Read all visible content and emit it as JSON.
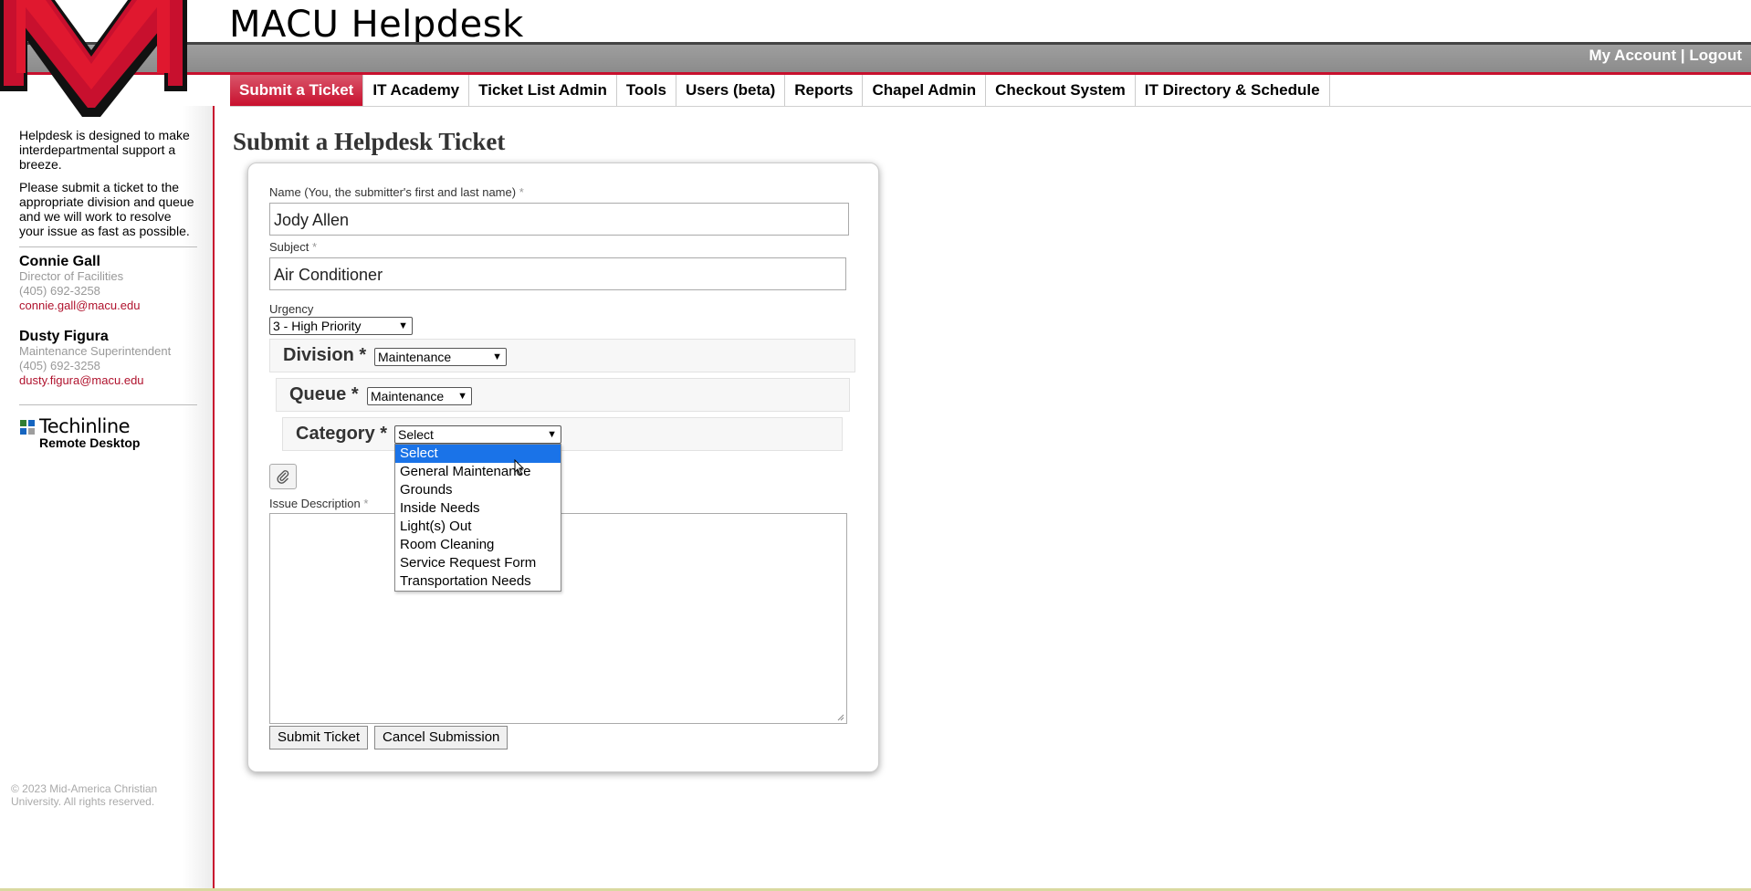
{
  "header": {
    "title": "MACU Helpdesk",
    "my_account": "My Account",
    "separator": "|",
    "logout": "Logout",
    "brand_color": "#c8102e"
  },
  "nav": {
    "items": [
      {
        "label": "Submit a Ticket",
        "active": true
      },
      {
        "label": "IT Academy"
      },
      {
        "label": "Ticket List Admin"
      },
      {
        "label": "Tools"
      },
      {
        "label": "Users (beta)"
      },
      {
        "label": "Reports"
      },
      {
        "label": "Chapel Admin"
      },
      {
        "label": "Checkout System"
      },
      {
        "label": "IT Directory & Schedule"
      }
    ]
  },
  "sidebar": {
    "intro1": "Helpdesk is designed to make interdepartmental support a breeze.",
    "intro2": "Please submit a ticket to the appropriate division and queue and we will work to resolve your issue as fast as possible.",
    "contacts": [
      {
        "name": "Connie Gall",
        "title": "Director of Facilities",
        "phone": "(405) 692-3258",
        "email": "connie.gall@macu.edu"
      },
      {
        "name": "Dusty Figura",
        "title": "Maintenance Superintendent",
        "phone": "(405) 692-3258",
        "email": "dusty.figura@macu.edu"
      }
    ],
    "techinline_title": "Techinline",
    "techinline_sub": "Remote Desktop",
    "copyright": "© 2023 Mid-America Christian University. All rights reserved."
  },
  "main": {
    "page_title": "Submit a Helpdesk Ticket",
    "name_label": "Name (You, the submitter's first and last name)",
    "name_value": "Jody Allen",
    "subject_label": "Subject",
    "subject_value": "Air Conditioner",
    "urgency_label": "Urgency",
    "urgency_value": "3 - High Priority",
    "division_label": "Division",
    "division_value": "Maintenance",
    "queue_label": "Queue",
    "queue_value": "Maintenance",
    "category_label": "Category",
    "category_value": "Select",
    "required_mark": "*",
    "issue_label": "Issue Description",
    "submit_label": "Submit Ticket",
    "cancel_label": "Cancel Submission"
  },
  "category_options": [
    {
      "label": "Select",
      "selected": true
    },
    {
      "label": "General Maintenance"
    },
    {
      "label": "Grounds"
    },
    {
      "label": "Inside Needs"
    },
    {
      "label": "Light(s) Out"
    },
    {
      "label": "Room Cleaning"
    },
    {
      "label": "Service Request Form"
    },
    {
      "label": "Transportation Needs"
    }
  ]
}
